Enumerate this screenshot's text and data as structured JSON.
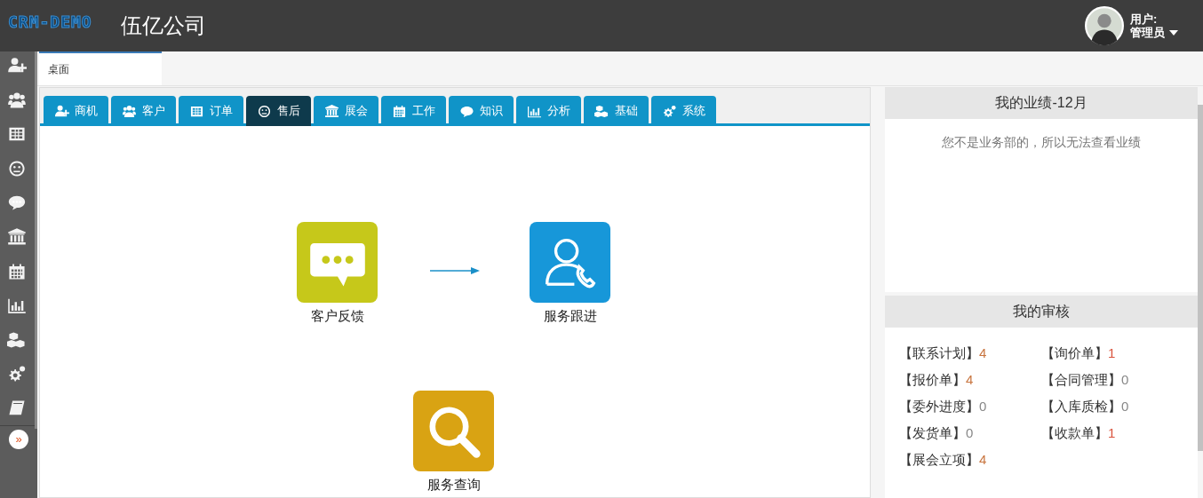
{
  "header": {
    "logo": "CRM-DEMO",
    "company": "伍亿公司",
    "user_label": "用户:",
    "user_name": "管理员"
  },
  "sidebar": {
    "expand": "»"
  },
  "page_tabs": [
    {
      "label": "桌面",
      "selected": true
    }
  ],
  "module_tabs": [
    {
      "label": "商机",
      "selected": false
    },
    {
      "label": "客户",
      "selected": false
    },
    {
      "label": "订单",
      "selected": false
    },
    {
      "label": "售后",
      "selected": true
    },
    {
      "label": "展会",
      "selected": false
    },
    {
      "label": "工作",
      "selected": false
    },
    {
      "label": "知识",
      "selected": false
    },
    {
      "label": "分析",
      "selected": false
    },
    {
      "label": "基础",
      "selected": false
    },
    {
      "label": "系统",
      "selected": false
    }
  ],
  "flow": {
    "nodes": [
      {
        "label": "客户反馈",
        "kind": "chat",
        "color": "#c6c81a"
      },
      {
        "label": "服务跟进",
        "kind": "phone",
        "color": "#1797d9"
      },
      {
        "label": "服务查询",
        "kind": "search",
        "color": "#d9a313"
      }
    ]
  },
  "performance": {
    "title": "我的业绩-12月",
    "message": "您不是业务部的，所以无法查看业绩"
  },
  "review": {
    "title": "我的审核",
    "items": [
      {
        "label": "【联系计划】",
        "count": "4",
        "color": "#c8743e"
      },
      {
        "label": "【询价单】",
        "count": "1",
        "color": "#d9533c"
      },
      {
        "label": "【报价单】",
        "count": "4",
        "color": "#c8743e"
      },
      {
        "label": "【合同管理】",
        "count": "0",
        "color": "#888888"
      },
      {
        "label": "【委外进度】",
        "count": "0",
        "color": "#888888"
      },
      {
        "label": "【入库质检】",
        "count": "0",
        "color": "#888888"
      },
      {
        "label": "【发货单】",
        "count": "0",
        "color": "#888888"
      },
      {
        "label": "【收款单】",
        "count": "1",
        "color": "#d9533c"
      },
      {
        "label": "【展会立项】",
        "count": "4",
        "color": "#c8743e"
      }
    ]
  }
}
